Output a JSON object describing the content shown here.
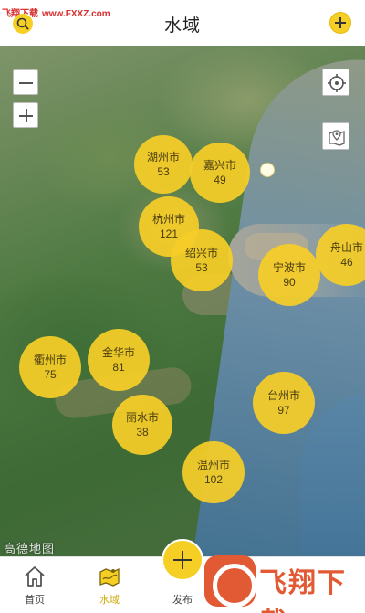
{
  "watermark": {
    "site": "飞翔下载",
    "url": "www.FXXZ.com",
    "brand": "飞翔下载"
  },
  "header": {
    "title": "水域"
  },
  "map": {
    "provider": "高德地图",
    "clusters": [
      {
        "city": "湖州市",
        "count": "53"
      },
      {
        "city": "嘉兴市",
        "count": "49"
      },
      {
        "city": "杭州市",
        "count": "121"
      },
      {
        "city": "绍兴市",
        "count": "53"
      },
      {
        "city": "宁波市",
        "count": "90"
      },
      {
        "city": "舟山市",
        "count": "46"
      },
      {
        "city": "衢州市",
        "count": "75"
      },
      {
        "city": "金华市",
        "count": "81"
      },
      {
        "city": "丽水市",
        "count": "38"
      },
      {
        "city": "台州市",
        "count": "97"
      },
      {
        "city": "温州市",
        "count": "102"
      }
    ]
  },
  "tabbar": {
    "home": "首页",
    "water": "水域",
    "publish": "发布"
  },
  "colors": {
    "accent": "#f6cf24",
    "active_tab": "#d2a90b"
  },
  "icons": {
    "search": "search-icon",
    "add": "plus-icon",
    "zoom_out": "minus-icon",
    "zoom_in": "plus-icon",
    "locate": "crosshair-icon",
    "layers": "map-pin-icon",
    "home": "home-icon",
    "water": "water-map-icon"
  }
}
